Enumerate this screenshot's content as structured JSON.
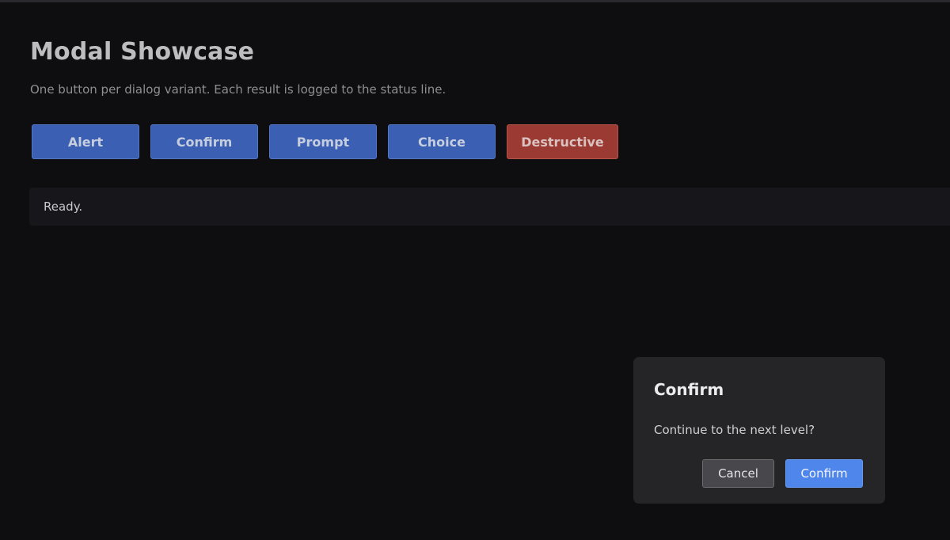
{
  "page": {
    "title": "Modal Showcase",
    "subtitle": "One button per dialog variant. Each result is logged to the status line."
  },
  "variants": {
    "alert_label": "Alert",
    "confirm_label": "Confirm",
    "prompt_label": "Prompt",
    "choice_label": "Choice",
    "destructive_label": "Destructive"
  },
  "status": {
    "text": "Ready."
  },
  "dialog": {
    "title": "Confirm",
    "message": "Continue to the next level?",
    "cancel_label": "Cancel",
    "confirm_label": "Confirm"
  },
  "colors": {
    "background": "#0e0e10",
    "primary_button": "#3b5fb3",
    "destructive_button": "#9a3a32",
    "dialog_background": "#252527",
    "dialog_confirm": "#4f86ec",
    "dialog_cancel": "#48484c"
  }
}
